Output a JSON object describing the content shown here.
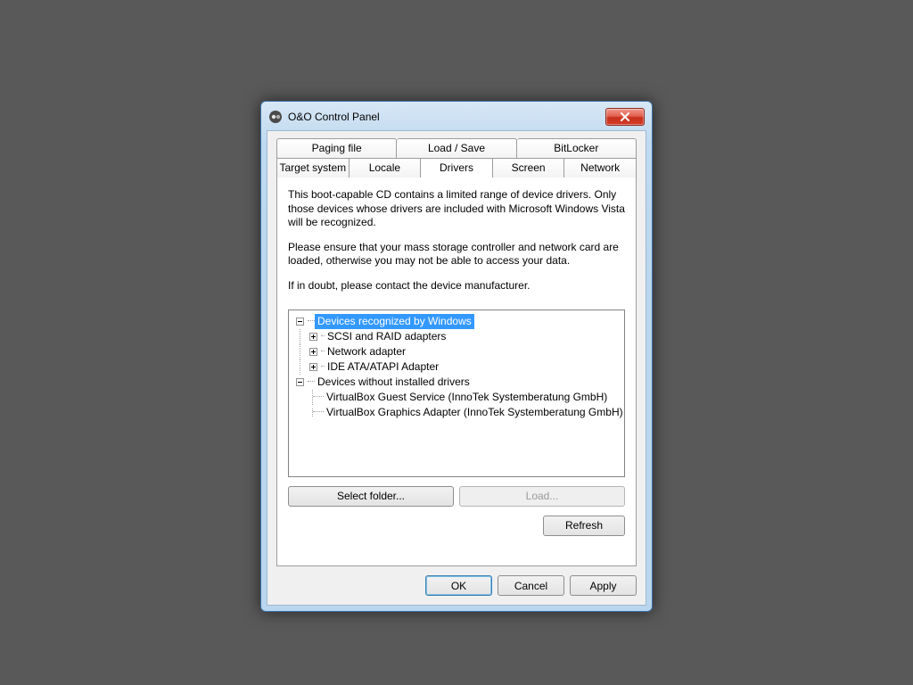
{
  "window": {
    "title": "O&O Control Panel"
  },
  "tabs": {
    "row1": [
      "Paging file",
      "Load / Save",
      "BitLocker"
    ],
    "row2": [
      "Target system",
      "Locale",
      "Drivers",
      "Screen",
      "Network"
    ],
    "active": "Drivers"
  },
  "description": {
    "p1": "This boot-capable CD contains a limited range of device drivers. Only those devices whose drivers are included with Microsoft Windows Vista will be recognized.",
    "p2": "Please ensure that your mass storage controller and network card are loaded, otherwise you may not be able to access your data.",
    "p3": "If in doubt, please contact the device manufacturer."
  },
  "tree": {
    "root1": {
      "label": "Devices recognized by Windows",
      "selected": true,
      "expanded": true,
      "children": [
        "SCSI and RAID adapters",
        "Network adapter",
        "IDE ATA/ATAPI Adapter"
      ]
    },
    "root2": {
      "label": "Devices without installed drivers",
      "expanded": true,
      "children": [
        "VirtualBox Guest Service (InnoTek Systemberatung GmbH)",
        "VirtualBox Graphics Adapter (InnoTek Systemberatung GmbH)"
      ]
    }
  },
  "buttons": {
    "select_folder": "Select folder...",
    "load": "Load...",
    "refresh": "Refresh",
    "ok": "OK",
    "cancel": "Cancel",
    "apply": "Apply"
  }
}
